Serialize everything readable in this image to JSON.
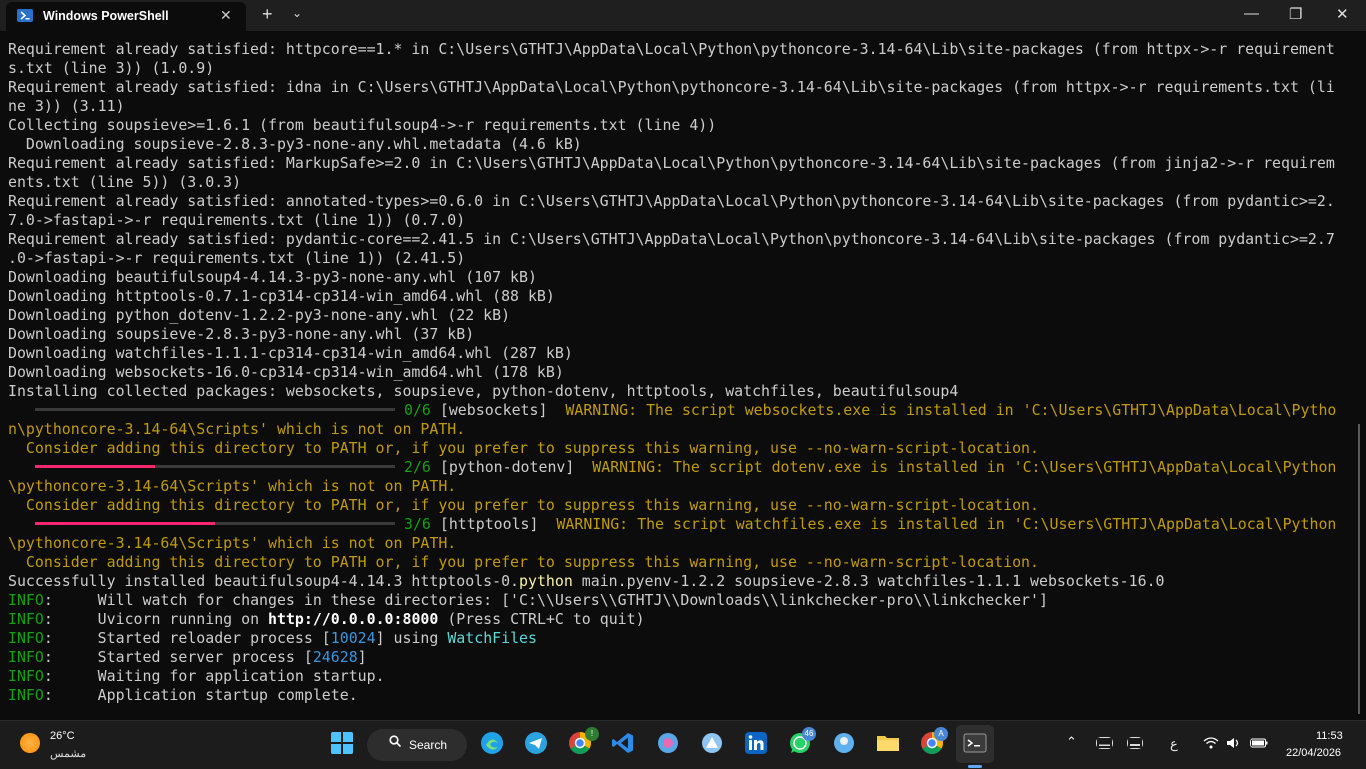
{
  "window": {
    "tab_title": "Windows PowerShell",
    "tab_close": "✕",
    "new_tab": "+",
    "dropdown": "⌄",
    "minimize": "—",
    "maximize": "❐",
    "close": "✕"
  },
  "terminal": {
    "l1": "Requirement already satisfied: httpcore==1.* in C:\\Users\\GTHTJ\\AppData\\Local\\Python\\pythoncore-3.14-64\\Lib\\site-packages (from httpx->-r requirement",
    "l2": "s.txt (line 3)) (1.0.9)",
    "l3": "Requirement already satisfied: idna in C:\\Users\\GTHTJ\\AppData\\Local\\Python\\pythoncore-3.14-64\\Lib\\site-packages (from httpx->-r requirements.txt (li",
    "l4": "ne 3)) (3.11)",
    "l5": "Collecting soupsieve>=1.6.1 (from beautifulsoup4->-r requirements.txt (line 4))",
    "l6": "  Downloading soupsieve-2.8.3-py3-none-any.whl.metadata (4.6 kB)",
    "l7": "Requirement already satisfied: MarkupSafe>=2.0 in C:\\Users\\GTHTJ\\AppData\\Local\\Python\\pythoncore-3.14-64\\Lib\\site-packages (from jinja2->-r requirem",
    "l8": "ents.txt (line 5)) (3.0.3)",
    "l9": "Requirement already satisfied: annotated-types>=0.6.0 in C:\\Users\\GTHTJ\\AppData\\Local\\Python\\pythoncore-3.14-64\\Lib\\site-packages (from pydantic>=2.",
    "l10": "7.0->fastapi->-r requirements.txt (line 1)) (0.7.0)",
    "l11": "Requirement already satisfied: pydantic-core==2.41.5 in C:\\Users\\GTHTJ\\AppData\\Local\\Python\\pythoncore-3.14-64\\Lib\\site-packages (from pydantic>=2.7",
    "l12": ".0->fastapi->-r requirements.txt (line 1)) (2.41.5)",
    "l13": "Downloading beautifulsoup4-4.14.3-py3-none-any.whl (107 kB)",
    "l14": "Downloading httptools-0.7.1-cp314-cp314-win_amd64.whl (88 kB)",
    "l15": "Downloading python_dotenv-1.2.2-py3-none-any.whl (22 kB)",
    "l16": "Downloading soupsieve-2.8.3-py3-none-any.whl (37 kB)",
    "l17": "Downloading watchfiles-1.1.1-cp314-cp314-win_amd64.whl (287 kB)",
    "l18": "Downloading websockets-16.0-cp314-cp314-win_amd64.whl (178 kB)",
    "l19": "Installing collected packages: websockets, soupsieve, python-dotenv, httptools, watchfiles, beautifulsoup4",
    "p0_count": "0/6",
    "p0_pkg": " [websockets]  ",
    "p0_warn": "WARNING: The script websockets.exe is installed in 'C:\\Users\\GTHTJ\\AppData\\Local\\Pytho",
    "p0_warn2": "n\\pythoncore-3.14-64\\Scripts' which is not on PATH.",
    "consider": "  Consider adding this directory to PATH or, if you prefer to suppress this warning, use --no-warn-script-location.",
    "p1_count": "2/6",
    "p1_pkg": " [python-dotenv]  ",
    "p1_warn": "WARNING: The script dotenv.exe is installed in 'C:\\Users\\GTHTJ\\AppData\\Local\\Python",
    "p1_warn2": "\\pythoncore-3.14-64\\Scripts' which is not on PATH.",
    "p2_count": "3/6",
    "p2_pkg": " [httptools]  ",
    "p2_warn": "WARNING: The script watchfiles.exe is installed in 'C:\\Users\\GTHTJ\\AppData\\Local\\Python",
    "p2_warn2": "\\pythoncore-3.14-64\\Scripts' which is not on PATH.",
    "success_a": "Successfully installed beautifulsoup4-4.14.3 httptools-0.",
    "success_b": "python",
    "success_c": " main.pyenv-1.2.2 soupsieve-2.8.3 watchfiles-1.1.1 websockets-16.0",
    "info_label": "INFO",
    "info_colon": ":     ",
    "i1": "Will watch for changes in these directories: ['C:\\\\Users\\\\GTHTJ\\\\Downloads\\\\linkchecker-pro\\\\linkchecker']",
    "i2a": "Uvicorn running on ",
    "i2b": "http://0.0.0.0:8000",
    "i2c": " (Press CTRL+C to quit)",
    "i3a": "Started reloader process [",
    "i3b": "10024",
    "i3c": "] using ",
    "i3d": "WatchFiles",
    "i4a": "Started server process [",
    "i4b": "24628",
    "i4c": "]",
    "i5": "Waiting for application startup.",
    "i6": "Application startup complete."
  },
  "progress": [
    {
      "label": "0/6",
      "fraction": 0.0
    },
    {
      "label": "2/6",
      "fraction": 0.333
    },
    {
      "label": "3/6",
      "fraction": 0.5
    }
  ],
  "colors": {
    "progress_fill": "#f92672",
    "progress_track": "#3a3a3a",
    "warning": "#c19c00",
    "info": "#13a10e"
  },
  "taskbar": {
    "weather_temp": "26°C",
    "weather_cond": "مشمس",
    "search_label": "Search",
    "badge_whatsapp": "46",
    "badge_chrome1": "!",
    "badge_chrome2": "A",
    "input_lang": "ع",
    "time": "11:53",
    "date": "22/04/2026",
    "icons": [
      "windows-start-icon",
      "search-icon",
      "edge-icon",
      "telegram-icon",
      "chrome-icon",
      "vscode-icon",
      "copilot-icon",
      "photos-icon",
      "linkedin-icon",
      "whatsapp-icon",
      "maps-icon",
      "file-explorer-icon",
      "chrome-profile-icon",
      "terminal-icon"
    ]
  }
}
